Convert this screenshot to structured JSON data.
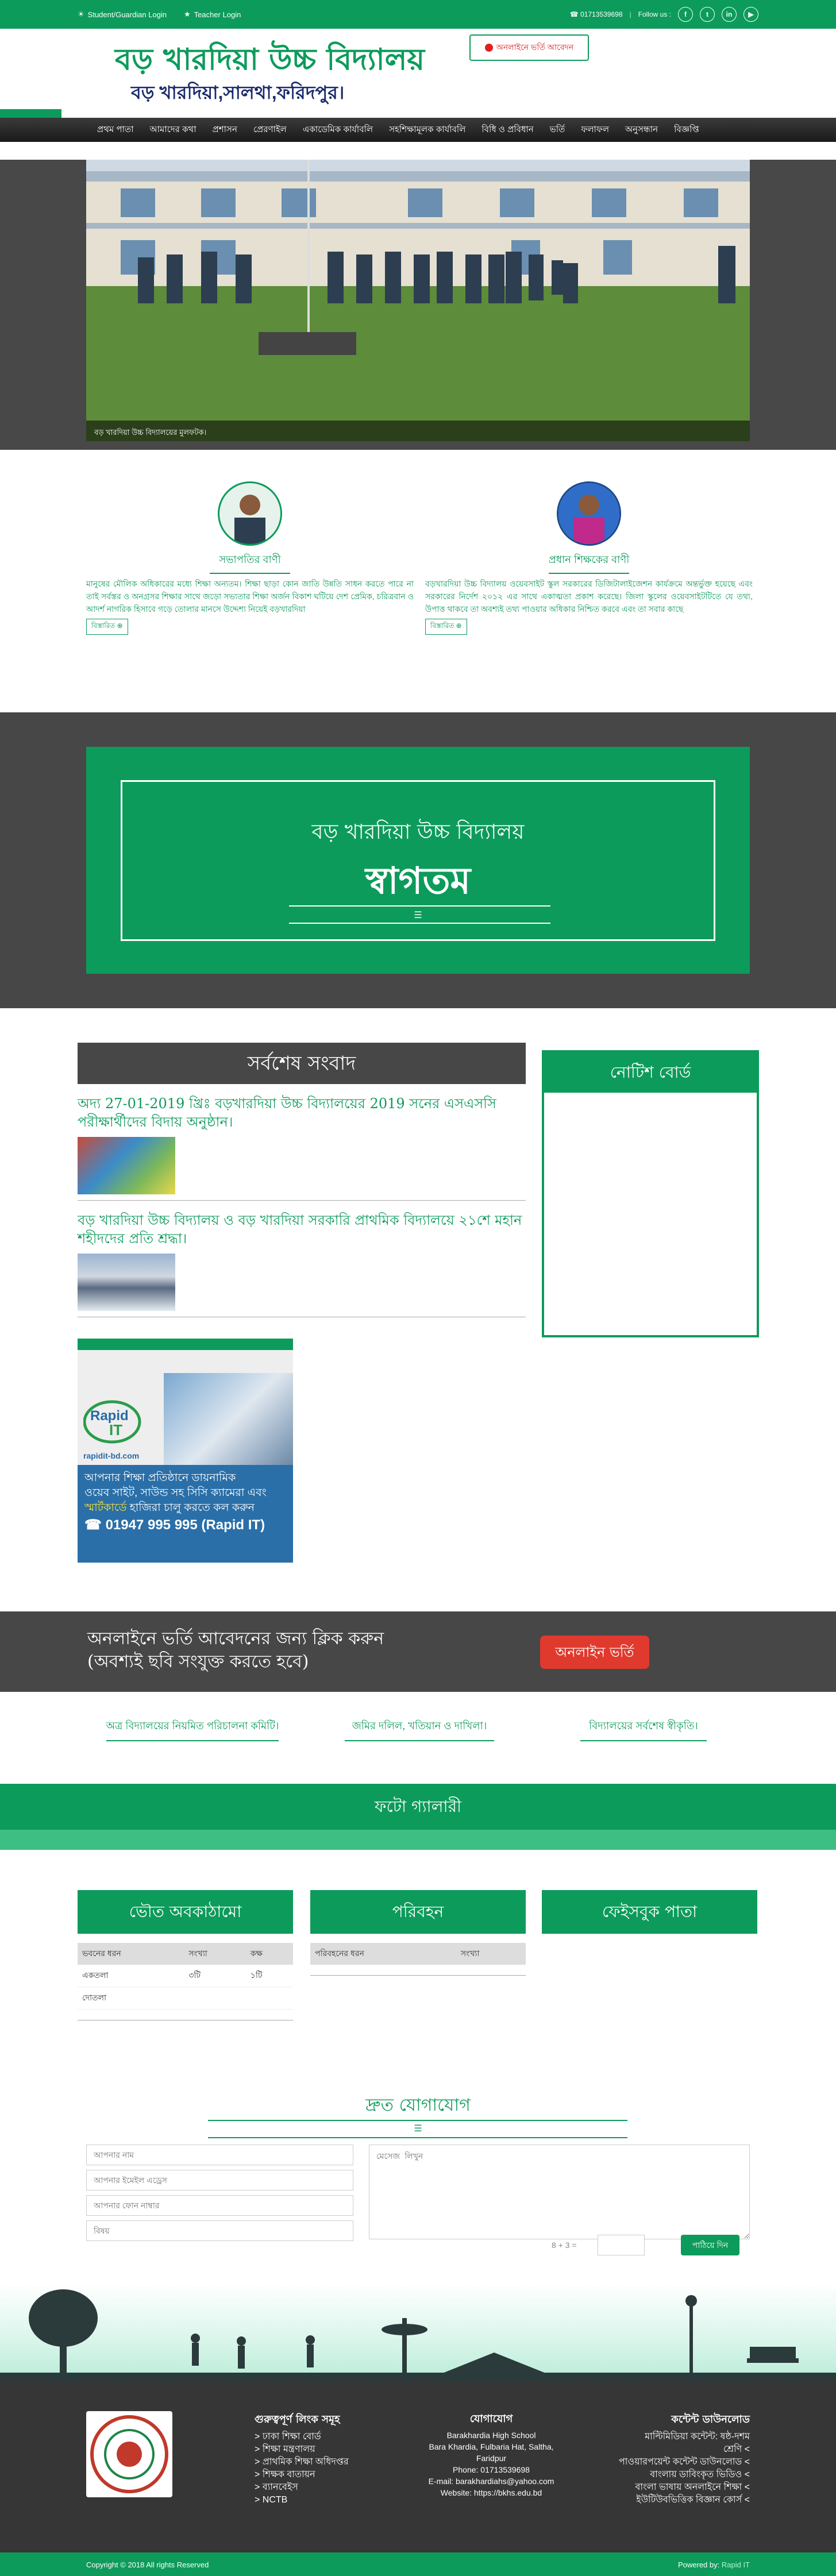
{
  "topbar": {
    "student_login": "Student/Guardian Login",
    "teacher_login": "Teacher Login",
    "phone": "01713539698",
    "follow_us": "Follow us :",
    "social": [
      "f",
      "t",
      "in",
      "▶"
    ]
  },
  "header": {
    "school_name": "বড় খারদিয়া উচ্চ বিদ্যালয়",
    "school_address": "বড় খারদিয়া,সালথা,ফরিদপুর।",
    "badge_text": "অনলাইনে ভর্তি আবেদন"
  },
  "nav": {
    "items": [
      "প্রথম পাতা",
      "আমাদের কথা",
      "প্রশাসন",
      "প্রেরণাইল",
      "একাডেমিক কার্যাবলি",
      "সহশিক্ষামূলক কার্যাবলি",
      "বিধি ও প্রবিধান",
      "ভর্তি",
      "ফলাফল",
      "অনুসন্ধান",
      "বিজ্ঞপ্তি"
    ]
  },
  "slider": {
    "caption": "বড় খারদিয়া উচ্চ বিদ্যালয়ের মুলফটক।"
  },
  "messages": {
    "chairman": {
      "title": "সভাপতির বাণী",
      "text": "মানুষের মৌলিক অধিকারের মধ্যে শিক্ষা অন্যতম। শিক্ষা ছাড়া কোন জাতি উন্নতি সাধন করতে পারে না তাই সর্বস্তর ও অনগ্রসর শিক্ষার সাথে জড়ো সভ্যতার শিক্ষা অর্জন বিকাশ ঘটিয়ে দেশ প্রেমিক, চরিত্রবান ও আদর্শ নাগরিক হিসাবে গড়ে তোলার মানসে উদ্দেশ্য নিয়েই বড়খারদিয়া",
      "more": "বিস্তারিত"
    },
    "headmaster": {
      "title": "প্রধান শিক্ষকের বাণী",
      "text": "বড়খারদিয়া উচ্চ বিদ্যালয় ওয়েবসাইট স্কুল সরকারের ডিজিটালাইজেশন কার্যক্রমে অন্তর্ভুক্ত হয়েছে এবং সরকারের নির্দেশ ২০১২ এর সাথে একাত্মতা প্রকাশ করেছে। জিলা স্কুলের ওয়েবসাইটটিতে যে তথ্য, উপাত্ত থাকবে তা অবশ্যই তথ্য পাওয়ার অধিকার নিশ্চিত করবে এবং তা সবার কাছে",
      "more": "বিস্তারিত"
    }
  },
  "welcome": {
    "school": "বড় খারদিয়া উচ্চ বিদ্যালয়",
    "word": "স্বাগতম"
  },
  "news": {
    "heading": "সর্বশেষ সংবাদ",
    "items": [
      {
        "title": "অদ্য 27-01-2019 খ্রিঃ বড়খারদিয়া উচ্চ বিদ্যালয়ের 2019 সনের এসএসসি পরীক্ষার্থীদের বিদায় অনুষ্ঠান।"
      },
      {
        "title": "বড় খারদিয়া উচ্চ বিদ্যালয় ও বড় খারদিয়া সরকারি প্রাথমিক বিদ্যালয়ে ২১শে মহান শহীদদের প্রতি শ্রদ্ধা।"
      }
    ]
  },
  "notice_board": {
    "heading": "নোটিশ বোর্ড"
  },
  "ad": {
    "site": "rapidit-bd.com",
    "line1": "আপনার শিক্ষা প্রতিষ্ঠানে ডায়নামিক",
    "line2": "ওয়েব সাইট, সাউন্ড সহ সিসি ক্যামেরা এবং",
    "highlight": "স্মার্টকার্ডে",
    "line3": "হাজিরা চালু করতে কল করুন",
    "phone": "01947 995 995 (Rapid IT)"
  },
  "admission": {
    "line1": "অনলাইনে ভর্তি আবেদনের জন্য ক্লিক করুন",
    "line2": "(অবশ্যই ছবি সংযুক্ত করতে হবে)",
    "button": "অনলাইন ভর্তি"
  },
  "tri_links": [
    "অত্র বিদ্যালয়ের নিয়মিত পরিচালনা কমিটি।",
    "জমির দলিল, খতিয়ান ও দাখিলা।",
    "বিদ্যালয়ের সর্বশেষ স্বীকৃতি।"
  ],
  "gallery": {
    "heading": "ফটো গ্যালারী"
  },
  "panels": {
    "infra": {
      "heading": "ভৌত অবকাঠামো",
      "cols": [
        "ভবনের ধরন",
        "সংখ্যা",
        "কক্ষ"
      ],
      "rows": [
        [
          "একতলা",
          "৩টি",
          "১টি"
        ],
        [
          "দোতলা",
          "",
          ""
        ]
      ]
    },
    "transport": {
      "heading": "পরিবহন",
      "cols": [
        "পরিবহনের ধরন",
        "সংখ্যা"
      ]
    },
    "facebook": {
      "heading": "ফেইসবুক পাতা"
    }
  },
  "contact": {
    "heading": "দ্রুত যোগাযোগ",
    "name_ph": "আপনার নাম",
    "email_ph": "আপনার ইমেইল এড্রেস",
    "phone_ph": "আপনার ফোন নাম্বার",
    "subject_ph": "বিষয়",
    "message_ph": "মেসেজ লিখুন",
    "captcha": "8 + 3 =",
    "send": "পাঠিয়ে দিন"
  },
  "footer": {
    "links_heading": "গুরুত্বপূর্ণ লিংক সমূহ",
    "links": [
      "> ঢাকা শিক্ষা বোর্ড",
      "> শিক্ষা মন্ত্রণালয়",
      "> প্রাথমিক শিক্ষা অধিদপ্তর",
      "> শিক্ষক বাতায়ন",
      "> ব্যানবেইস",
      "> NCTB"
    ],
    "contact_heading": "যোগাযোগ",
    "contact_lines": [
      "Barakhardia High School",
      "Bara Khardia, Fulbaria Hat, Saltha,",
      "Faridpur",
      "Phone: 01713539698",
      "E-mail: barakhardiahs@yahoo.com",
      "Website: https://bkhs.edu.bd"
    ],
    "download_heading": "কন্টেন্ট ডাউনলোড",
    "downloads": [
      "মাল্টিমিডিয়া কন্টেন্ট: ষষ্ঠ-দশম",
      "শ্রেণি <",
      "পাওয়ারপয়েন্ট কন্টেন্ট ডাউনলোড <",
      "বাংলায় ডাবিংকৃত ভিডিও <",
      "বাংলা ভাষায় অনলাইনে শিক্ষা <",
      "ইউটিউবভিত্তিক বিজ্ঞান কোর্স <"
    ],
    "copyright": "Copyright © 2018 All rights Reserved",
    "powered_by": "Powered by:",
    "powered_name": "Rapid IT"
  },
  "colors": {
    "brand_green": "#0d9b5b",
    "dark_bar": "#474747",
    "admission_red": "#e03a2e"
  },
  "icons": [
    "student-login-icon",
    "teacher-login-icon",
    "phone-icon",
    "facebook-icon",
    "twitter-icon",
    "linkedin-icon",
    "youtube-icon",
    "book-icon",
    "plus-circle-icon"
  ]
}
